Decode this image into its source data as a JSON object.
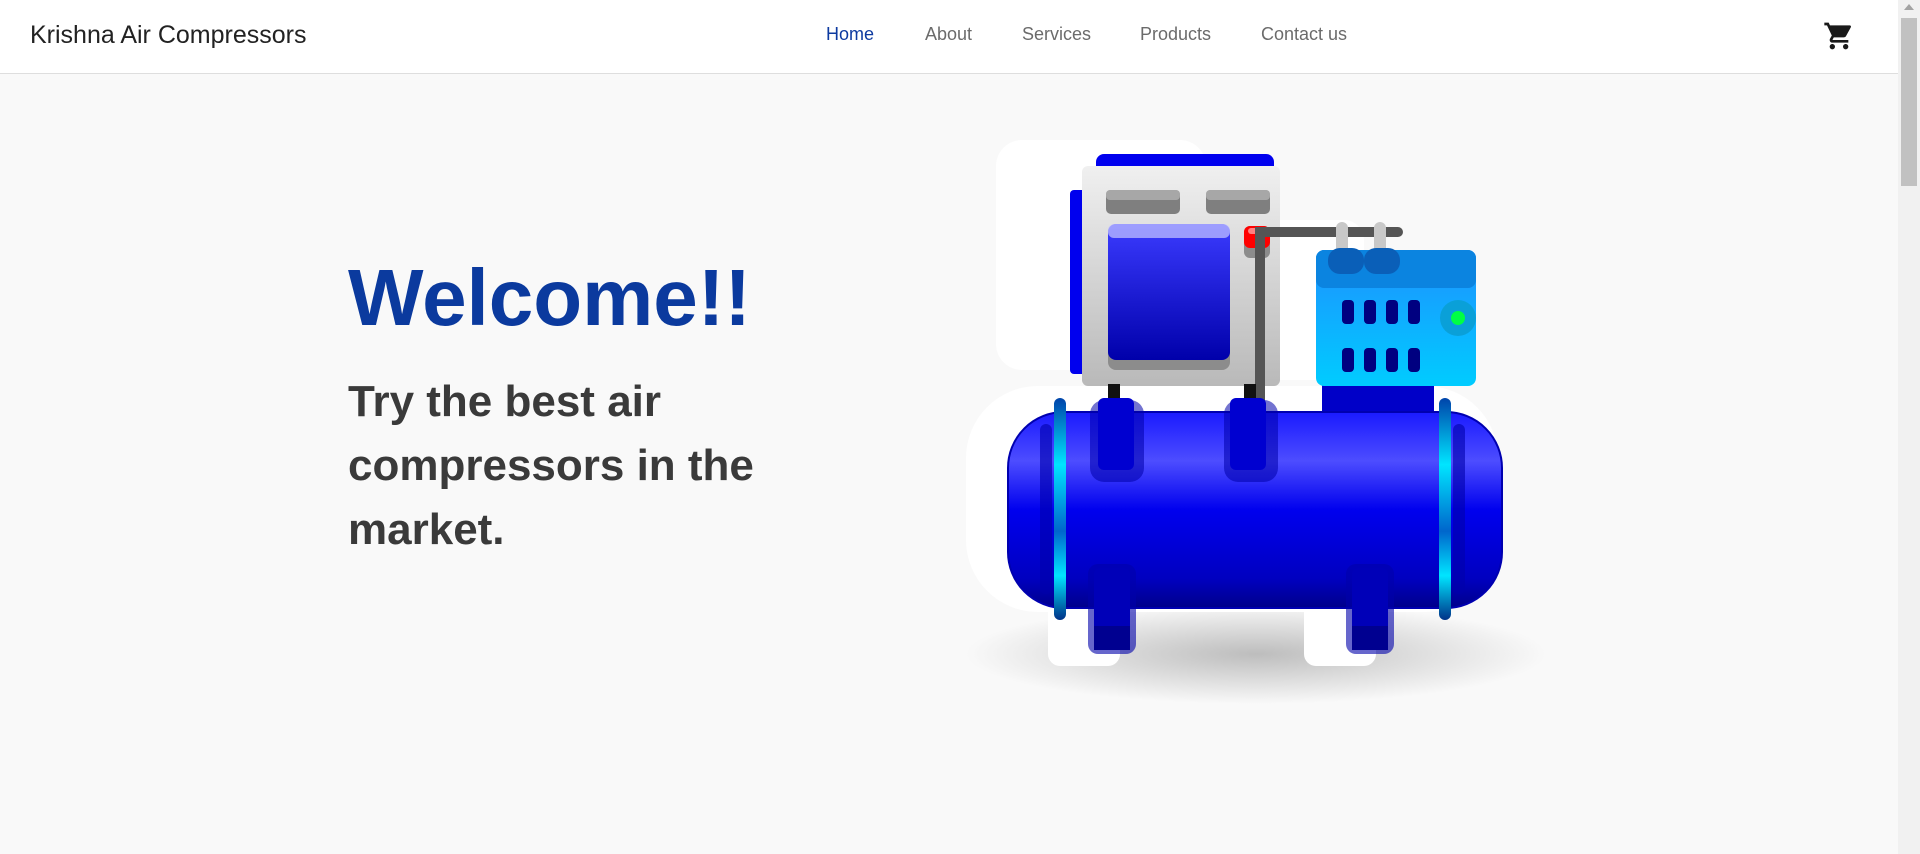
{
  "nav": {
    "brand": "Krishna Air Compressors",
    "links": [
      {
        "label": "Home",
        "active": true
      },
      {
        "label": "About",
        "active": false
      },
      {
        "label": "Services",
        "active": false
      },
      {
        "label": "Products",
        "active": false
      },
      {
        "label": "Contact us",
        "active": false
      }
    ],
    "cart_icon": "shopping-cart-icon"
  },
  "hero": {
    "title": "Welcome!!",
    "subtitle": "Try the best air compressors in the market.",
    "image_icon": "air-compressor-illustration"
  },
  "colors": {
    "accent": "#0d3aa0",
    "nav_text": "#6b6b6b",
    "headline": "#0b3a9e",
    "subtitle": "#3a3a3a",
    "tank_blue": "#0000ee",
    "panel_cyan": "#00aaff"
  }
}
